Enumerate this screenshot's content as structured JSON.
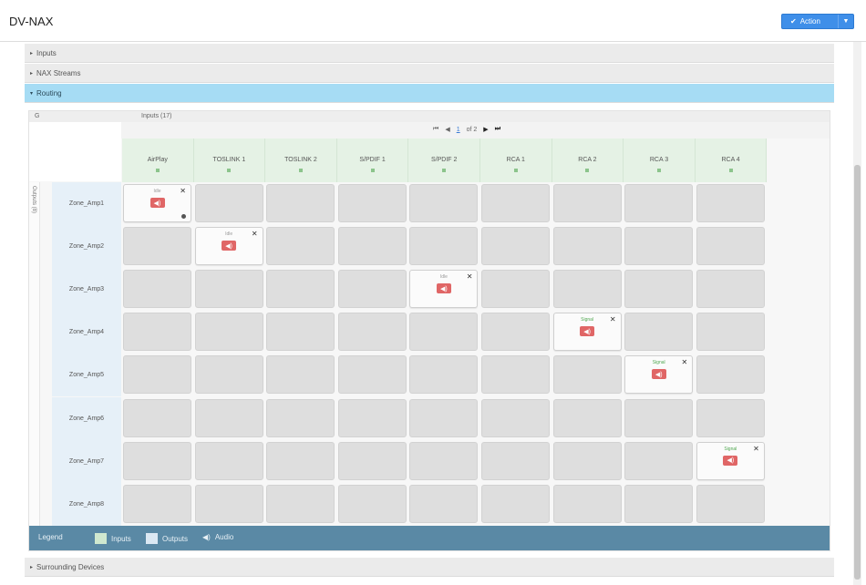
{
  "header": {
    "title": "DV-NAX",
    "action_label": "Action",
    "action_icon": "check-icon"
  },
  "sections": {
    "inputs": "Inputs",
    "nax_streams": "NAX Streams",
    "routing": "Routing",
    "bottom": "Surrounding Devices"
  },
  "panel": {
    "g": "G",
    "count": "Inputs (17)"
  },
  "pager": {
    "page": "1",
    "of": "of 2"
  },
  "side_label": "Outputs (8)",
  "columns": [
    "AirPlay",
    "TOSLINK 1",
    "TOSLINK 2",
    "S/PDIF 1",
    "S/PDIF 2",
    "RCA 1",
    "RCA 2",
    "RCA 3",
    "RCA 4"
  ],
  "rows": [
    "Zone_Amp1",
    "Zone_Amp2",
    "Zone_Amp3",
    "Zone_Amp4",
    "Zone_Amp5",
    "Zone_Amp6",
    "Zone_Amp7",
    "Zone_Amp8"
  ],
  "routes": [
    {
      "row": 0,
      "col": 0,
      "status": "Idle",
      "ok": false
    },
    {
      "row": 1,
      "col": 1,
      "status": "Idle",
      "ok": false
    },
    {
      "row": 2,
      "col": 4,
      "status": "Idle",
      "ok": false
    },
    {
      "row": 3,
      "col": 6,
      "status": "Signal",
      "ok": true
    },
    {
      "row": 4,
      "col": 7,
      "status": "Signal",
      "ok": true
    },
    {
      "row": 6,
      "col": 8,
      "status": "Signal",
      "ok": true
    }
  ],
  "legend": {
    "title": "Legend",
    "inputs": "Inputs",
    "outputs": "Outputs",
    "audio": "Audio"
  },
  "colors": {
    "accent": "#3f8fe9",
    "routing_bar": "#a6dcf4",
    "legend_bar": "#5a89a5",
    "input_header": "#e5f2e5",
    "output_header": "#e6f0f8",
    "speaker": "#e06666"
  }
}
